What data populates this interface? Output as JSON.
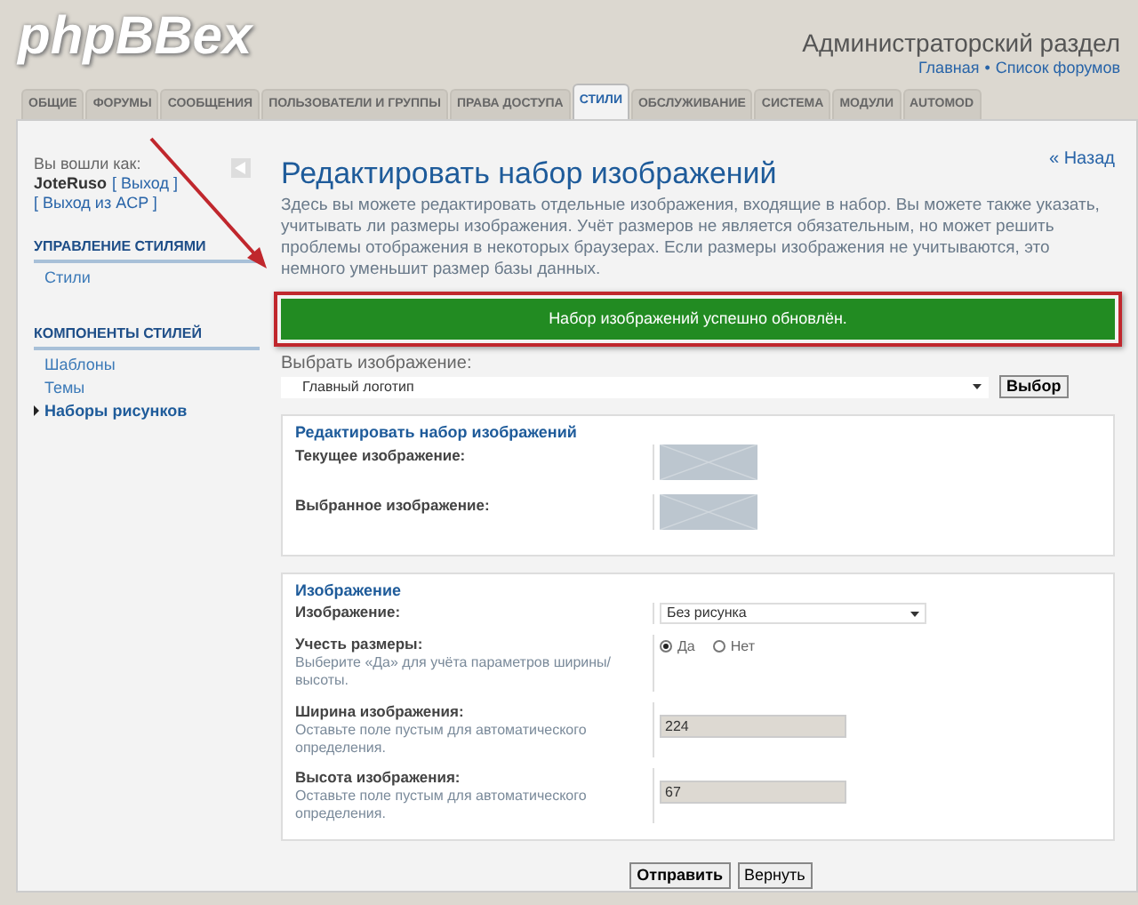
{
  "header": {
    "logo": "phpBBex",
    "title": "Администраторский раздел",
    "links": [
      {
        "label": "Главная"
      },
      {
        "label": "Список форумов"
      }
    ],
    "separator": "•"
  },
  "tabs": [
    {
      "label": "ОБЩИЕ",
      "selected": false
    },
    {
      "label": "ФОРУМЫ",
      "selected": false
    },
    {
      "label": "СООБЩЕНИЯ",
      "selected": false
    },
    {
      "label": "ПОЛЬЗОВАТЕЛИ И ГРУППЫ",
      "selected": false
    },
    {
      "label": "ПРАВА ДОСТУПА",
      "selected": false
    },
    {
      "label": "СТИЛИ",
      "selected": true
    },
    {
      "label": "ОБСЛУЖИВАНИЕ",
      "selected": false
    },
    {
      "label": "СИСТЕМА",
      "selected": false
    },
    {
      "label": "МОДУЛИ",
      "selected": false
    },
    {
      "label": "AUTOMOD",
      "selected": false
    }
  ],
  "sidebar": {
    "logged_in_as": "Вы вошли как:",
    "user": "JoteRuso",
    "logout": "[ Выход ]",
    "acp_logout": "[ Выход из ACP ]",
    "sections": [
      {
        "title": "УПРАВЛЕНИЕ СТИЛЯМИ",
        "items": [
          {
            "label": "Стили",
            "selected": false
          }
        ]
      },
      {
        "title": "КОМПОНЕНТЫ СТИЛЕЙ",
        "items": [
          {
            "label": "Шаблоны",
            "selected": false
          },
          {
            "label": "Темы",
            "selected": false
          },
          {
            "label": "Наборы рисунков",
            "selected": true
          }
        ]
      }
    ]
  },
  "content": {
    "title": "Редактировать набор изображений",
    "back": "« Назад",
    "description": "Здесь вы можете редактировать отдельные изображения, входящие в набор. Вы можете также указать, учитывать ли размеры изображения. Учёт размеров не является обязательным, но может решить проблемы отображения в некоторых браузерах. Если размеры изображения не учитываются, это немного уменьшит размер базы данных.",
    "success_message": "Набор изображений успешно обновлён.",
    "select_label": "Выбрать изображение:",
    "select_value": "Главный логотип",
    "select_button": "Выбор",
    "preview": {
      "legend": "Редактировать набор изображений",
      "rows": [
        {
          "label": "Текущее изображение:"
        },
        {
          "label": "Выбранное изображение:"
        }
      ]
    },
    "image_fieldset": {
      "legend": "Изображение",
      "rows": [
        {
          "kind": "select",
          "label": "Изображение:",
          "value": "Без рисунка"
        },
        {
          "kind": "radio",
          "label": "Учесть размеры:",
          "hint": "Выберите «Да» для учёта параметров ширины/высоты.",
          "options": [
            {
              "label": "Да",
              "selected": true
            },
            {
              "label": "Нет",
              "selected": false
            }
          ]
        },
        {
          "kind": "text",
          "label": "Ширина изображения:",
          "hint": "Оставьте поле пустым для автоматического определения.",
          "value": "224"
        },
        {
          "kind": "text",
          "label": "Высота изображения:",
          "hint": "Оставьте поле пустым для автоматического определения.",
          "value": "67"
        }
      ]
    },
    "buttons": [
      {
        "label": "Отправить",
        "primary": true
      },
      {
        "label": "Вернуть",
        "primary": false
      }
    ]
  }
}
